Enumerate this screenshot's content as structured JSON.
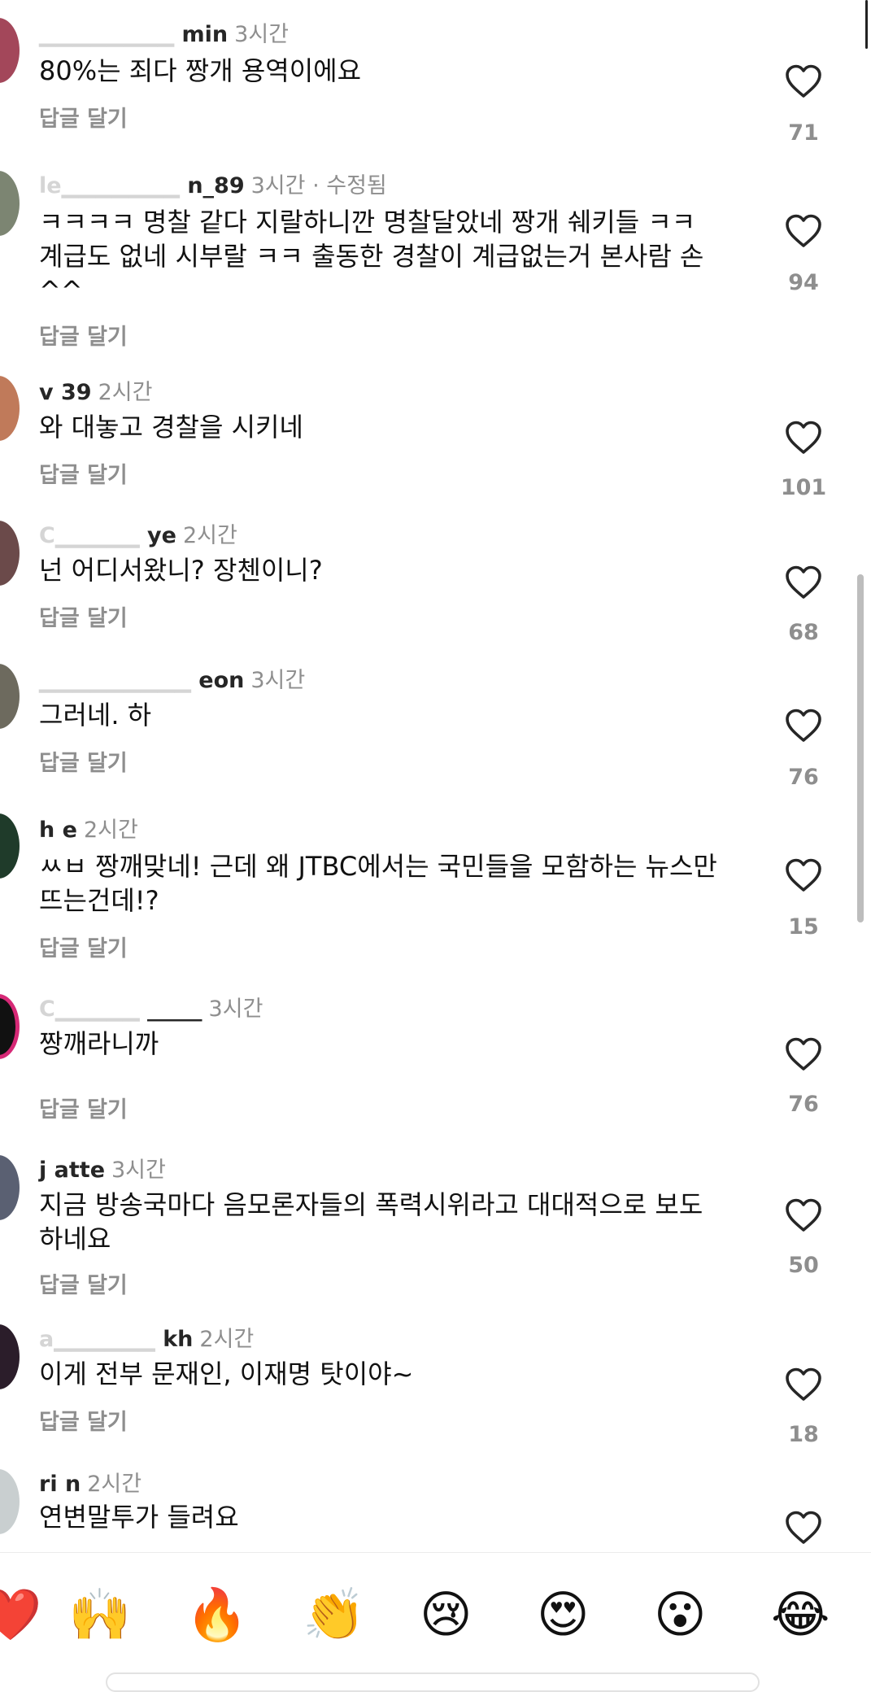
{
  "comments": [
    {
      "user_visible": "min",
      "time": "3시간",
      "text": "80%는  죄다 짱개 용역이에요",
      "reply": "답글 달기",
      "likes": "71"
    },
    {
      "user_visible": "n_89",
      "time": "3시간 · 수정됨",
      "text": "ㅋㅋㅋㅋ  명찰 같다 지랄하니깐 명찰달았네 짱개 쉐키들 ㅋㅋ 계급도 없네 시부랄 ㅋㅋ 출동한 경찰이 계급없는거 본사람 손 ^^",
      "reply": "답글 달기",
      "likes": "94"
    },
    {
      "user_visible": "v 39",
      "time": "2시간",
      "text": "와 대놓고 경찰을 시키네",
      "reply": "답글 달기",
      "likes": "101"
    },
    {
      "user_visible": "ye",
      "time": "2시간",
      "text": "넌 어디서왔니? 장첸이니?",
      "reply": "답글 달기",
      "likes": "68"
    },
    {
      "user_visible": "eon",
      "time": "3시간",
      "text": "그러네.  하",
      "reply": "답글 달기",
      "likes": "76"
    },
    {
      "user_visible": "h e",
      "time": "2시간",
      "text": "ㅆㅂ 짱깨맞네! 근데 왜 JTBC에서는 국민들을 모함하는 뉴스만 뜨는건데!?",
      "reply": "답글 달기",
      "likes": "15"
    },
    {
      "user_visible": "_____",
      "time": "3시간",
      "text": "짱깨라니까",
      "reply": "답글 달기",
      "likes": "76"
    },
    {
      "user_visible": "j atte",
      "time": "3시간",
      "text": "지금 방송국마다 음모론자들의 폭력시위라고 대대적으로 보도하네요",
      "reply": "답글 달기",
      "likes": "50"
    },
    {
      "user_visible": "kh",
      "time": "2시간",
      "text": "이게 전부 문재인, 이재명 탓이야~",
      "reply": "답글 달기",
      "likes": "18"
    },
    {
      "user_visible": "ri n",
      "time": "2시간",
      "text": "연변말투가 들려요",
      "reply": "",
      "likes": ""
    }
  ],
  "emoji_bar": [
    "❤️",
    "🙌",
    "🔥",
    "👏",
    "😢",
    "😍",
    "😮",
    "😂"
  ],
  "colors": {
    "like_icon": "#262626",
    "meta_text": "#8e8e8e",
    "story_ring": "#d62976"
  }
}
